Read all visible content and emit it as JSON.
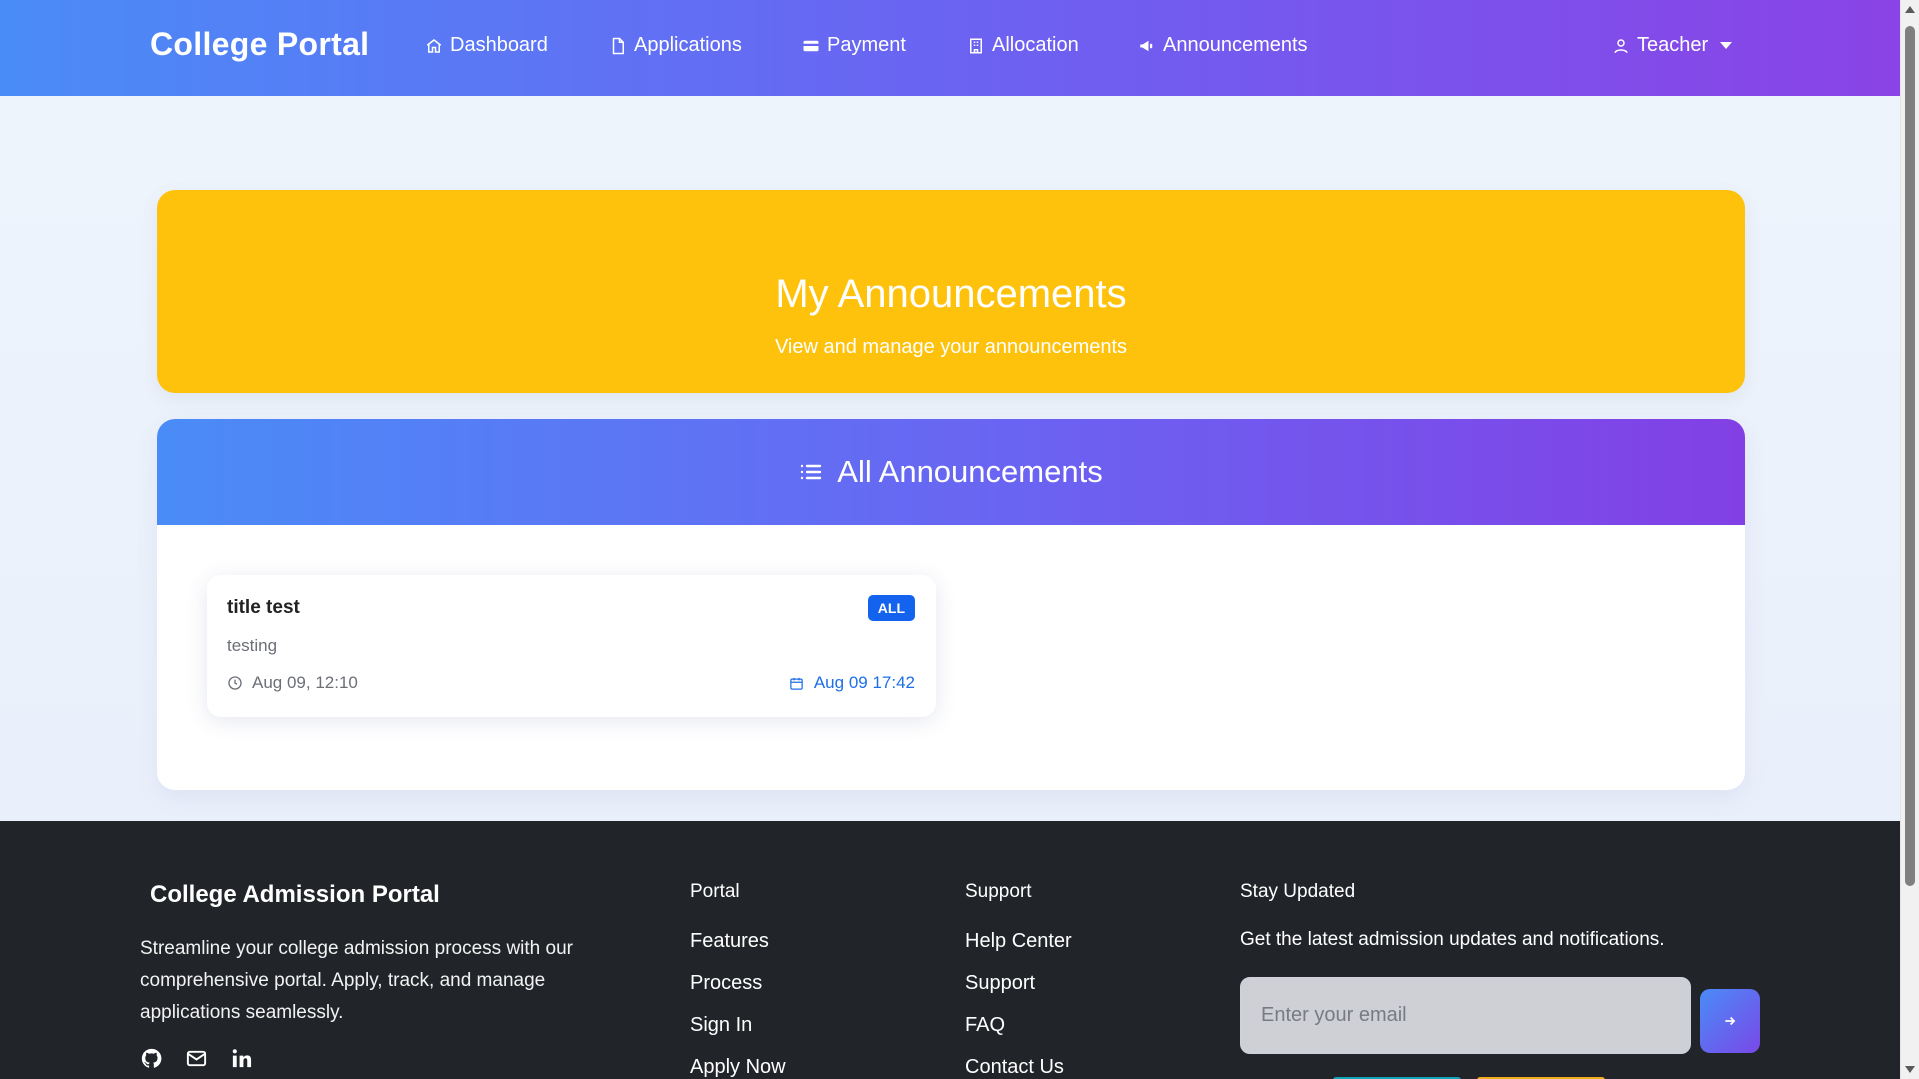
{
  "navbar": {
    "brand": "College Portal",
    "items": [
      {
        "label": "Dashboard",
        "icon": "home-icon"
      },
      {
        "label": "Applications",
        "icon": "file-icon"
      },
      {
        "label": "Payment",
        "icon": "credit-card-icon"
      },
      {
        "label": "Allocation",
        "icon": "building-icon"
      },
      {
        "label": "Announcements",
        "icon": "megaphone-icon"
      }
    ],
    "user": {
      "label": "Teacher",
      "icon": "user-icon"
    }
  },
  "hero": {
    "title": "My Announcements",
    "subtitle": "View and manage your announcements"
  },
  "panel": {
    "title": "All Announcements",
    "icon": "list-icon"
  },
  "announcements": [
    {
      "title": "title test",
      "badge": "ALL",
      "body": "testing",
      "created": "Aug 09, 12:10",
      "scheduled": "Aug 09 17:42"
    }
  ],
  "footer": {
    "brand": "College Admission Portal",
    "description": "Streamline your college admission process with our comprehensive portal. Apply, track, and manage applications seamlessly.",
    "socials": [
      "github-icon",
      "mail-icon",
      "linkedin-icon"
    ],
    "portal": {
      "title": "Portal",
      "links": [
        "Features",
        "Process",
        "Sign In",
        "Apply Now"
      ]
    },
    "support": {
      "title": "Support",
      "links": [
        "Help Center",
        "Support",
        "FAQ",
        "Contact Us"
      ]
    },
    "newsletter": {
      "title": "Stay Updated",
      "description": "Get the latest admission updates and notifications.",
      "placeholder": "Enter your email"
    }
  },
  "colors": {
    "navbar_gradient_start": "#4a8cf7",
    "navbar_gradient_end": "#8a43e6",
    "hero": "#fec20d",
    "badge": "#1463ef",
    "footer": "#212529"
  }
}
